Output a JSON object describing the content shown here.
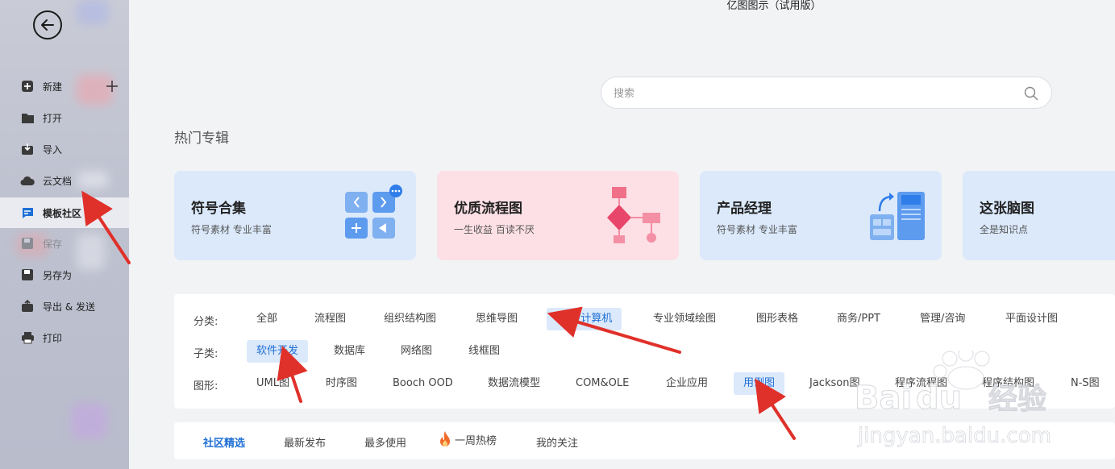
{
  "app_title": "亿图图示（试用版）",
  "sidebar": {
    "items": [
      {
        "label": "新建",
        "icon": "plus-box-icon"
      },
      {
        "label": "打开",
        "icon": "folder-icon"
      },
      {
        "label": "导入",
        "icon": "import-icon"
      },
      {
        "label": "云文档",
        "icon": "cloud-icon"
      },
      {
        "label": "模板社区",
        "icon": "chat-icon"
      },
      {
        "label": "保存",
        "icon": "save-icon"
      },
      {
        "label": "另存为",
        "icon": "save-as-icon"
      },
      {
        "label": "导出 & 发送",
        "icon": "export-icon"
      },
      {
        "label": "打印",
        "icon": "printer-icon"
      }
    ]
  },
  "search": {
    "placeholder": "搜索"
  },
  "section_title": "热门专辑",
  "cards": [
    {
      "title": "符号合集",
      "subtitle": "符号素材 专业丰富",
      "bg": "#dbe9fb"
    },
    {
      "title": "优质流程图",
      "subtitle": "一生收益 百读不厌",
      "bg": "#fde0e6"
    },
    {
      "title": "产品经理",
      "subtitle": "符号素材 专业丰富",
      "bg": "#dbe9fb"
    },
    {
      "title": "这张脑图",
      "subtitle": "全是知识点",
      "bg": "#dbe9fb"
    }
  ],
  "filters": {
    "category_label": "分类:",
    "categories": [
      "全部",
      "流程图",
      "组织结构图",
      "思维导图",
      "软件/计算机",
      "专业领域绘图",
      "图形表格",
      "商务/PPT",
      "管理/咨询",
      "平面设计图"
    ],
    "subcategory_label": "子类:",
    "subcategories": [
      "软件开发",
      "数据库",
      "网络图",
      "线框图"
    ],
    "shape_label": "图形:",
    "shapes": [
      "UML图",
      "时序图",
      "Booch OOD",
      "数据流模型",
      "COM&OLE",
      "企业应用",
      "用例图",
      "Jackson图",
      "程序流程图",
      "程序结构图",
      "N-S图"
    ]
  },
  "tabs": [
    "社区精选",
    "最新发布",
    "最多使用",
    "一周热榜",
    "我的关注"
  ],
  "watermark": {
    "brand": "Baidu经验",
    "url": "jingyan.baidu.com"
  },
  "colors": {
    "accent": "#1f6fd6",
    "selected_bg": "#dbe9fb",
    "arrow": "#e0302a"
  }
}
